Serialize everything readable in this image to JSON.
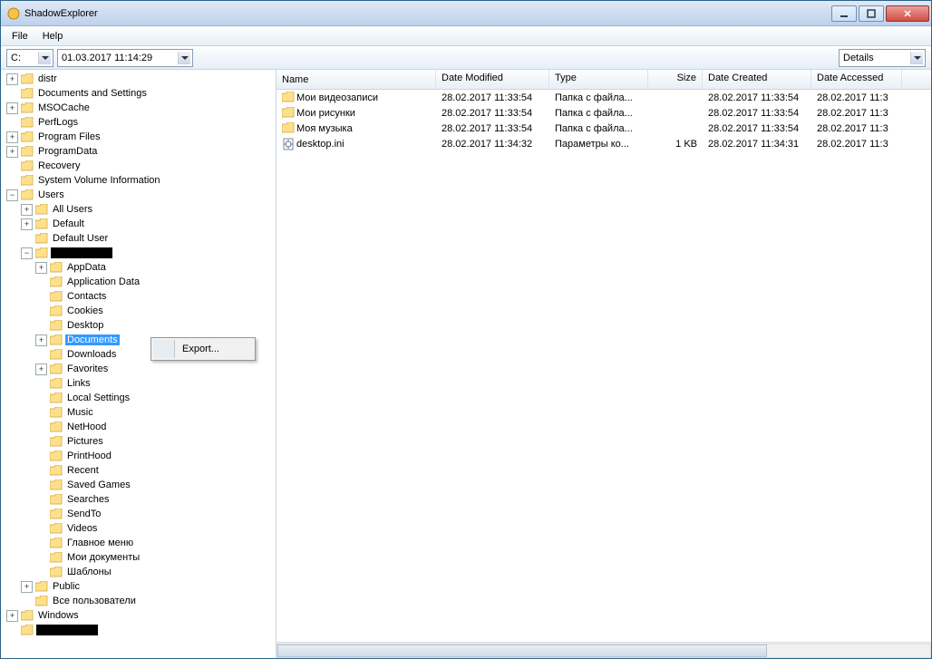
{
  "window": {
    "title": "ShadowExplorer"
  },
  "menu": {
    "file": "File",
    "help": "Help"
  },
  "toolbar": {
    "drive": "C:",
    "snapshot": "01.03.2017 11:14:29",
    "view": "Details"
  },
  "columns": {
    "name": "Name",
    "modified": "Date Modified",
    "type": "Type",
    "size": "Size",
    "created": "Date Created",
    "accessed": "Date Accessed"
  },
  "contextMenu": {
    "export": "Export..."
  },
  "tree": {
    "root": [
      {
        "label": "distr",
        "exp": "+"
      },
      {
        "label": "Documents and Settings"
      },
      {
        "label": "MSOCache",
        "exp": "+"
      },
      {
        "label": "PerfLogs"
      },
      {
        "label": "Program Files",
        "exp": "+"
      },
      {
        "label": "ProgramData",
        "exp": "+"
      },
      {
        "label": "Recovery"
      },
      {
        "label": "System Volume Information"
      },
      {
        "label": "Users",
        "exp": "-",
        "children": [
          {
            "label": "All Users",
            "exp": "+"
          },
          {
            "label": "Default",
            "exp": "+"
          },
          {
            "label": "Default User"
          },
          {
            "label": "REDACTED",
            "redacted": true,
            "exp": "-",
            "children": [
              {
                "label": "AppData",
                "exp": "+"
              },
              {
                "label": "Application Data"
              },
              {
                "label": "Contacts"
              },
              {
                "label": "Cookies"
              },
              {
                "label": "Desktop"
              },
              {
                "label": "Documents",
                "exp": "+",
                "selected": true
              },
              {
                "label": "Downloads"
              },
              {
                "label": "Favorites",
                "exp": "+"
              },
              {
                "label": "Links"
              },
              {
                "label": "Local Settings"
              },
              {
                "label": "Music"
              },
              {
                "label": "NetHood"
              },
              {
                "label": "Pictures"
              },
              {
                "label": "PrintHood"
              },
              {
                "label": "Recent"
              },
              {
                "label": "Saved Games"
              },
              {
                "label": "Searches"
              },
              {
                "label": "SendTo"
              },
              {
                "label": "Videos"
              },
              {
                "label": "Главное меню"
              },
              {
                "label": "Мои документы"
              },
              {
                "label": "Шаблоны"
              }
            ]
          },
          {
            "label": "Public",
            "exp": "+"
          },
          {
            "label": "Все пользователи"
          }
        ]
      },
      {
        "label": "Windows",
        "exp": "+"
      },
      {
        "label": "REDACTED2",
        "redacted": true
      }
    ]
  },
  "files": [
    {
      "icon": "folder",
      "name": "Мои видеозаписи",
      "modified": "28.02.2017 11:33:54",
      "type": "Папка с файла...",
      "size": "",
      "created": "28.02.2017 11:33:54",
      "accessed": "28.02.2017 11:3"
    },
    {
      "icon": "folder",
      "name": "Мои рисунки",
      "modified": "28.02.2017 11:33:54",
      "type": "Папка с файла...",
      "size": "",
      "created": "28.02.2017 11:33:54",
      "accessed": "28.02.2017 11:3"
    },
    {
      "icon": "folder",
      "name": "Моя музыка",
      "modified": "28.02.2017 11:33:54",
      "type": "Папка с файла...",
      "size": "",
      "created": "28.02.2017 11:33:54",
      "accessed": "28.02.2017 11:3"
    },
    {
      "icon": "ini",
      "name": "desktop.ini",
      "modified": "28.02.2017 11:34:32",
      "type": "Параметры ко...",
      "size": "1 KB",
      "created": "28.02.2017 11:34:31",
      "accessed": "28.02.2017 11:3"
    }
  ]
}
